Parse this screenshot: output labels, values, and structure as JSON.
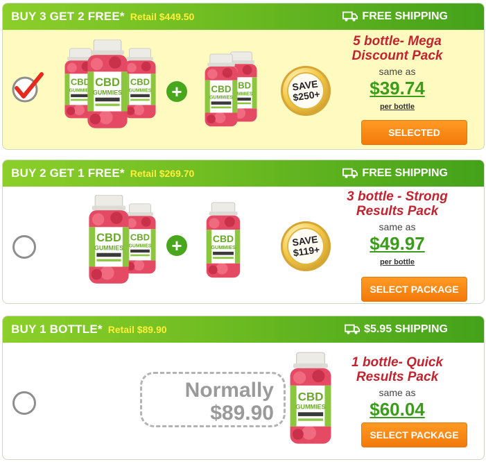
{
  "packages": [
    {
      "title": "BUY 3 GET 2 FREE*",
      "retail": "Retail $449.50",
      "shipping": "FREE SHIPPING",
      "selected": true,
      "name_line1": "5 bottle- Mega",
      "name_line2": "Discount Pack",
      "same_as": "same as",
      "price": "$39.74",
      "per_bottle": "per bottle",
      "button": "SELECTED",
      "badge_line1": "SAVE",
      "badge_line2": "$250+"
    },
    {
      "title": "BUY 2 GET 1 FREE*",
      "retail": "Retail $269.70",
      "shipping": "FREE SHIPPING",
      "selected": false,
      "name_line1": "3 bottle - Strong",
      "name_line2": "Results Pack",
      "same_as": "same as",
      "price": "$49.97",
      "per_bottle": "per bottle",
      "button": "SELECT PACKAGE",
      "badge_line1": "SAVE",
      "badge_line2": "$119+"
    },
    {
      "title": "BUY 1 BOTTLE*",
      "retail": "Retail $89.90",
      "shipping": "$5.95 SHIPPING",
      "selected": false,
      "name_line1": "1 bottle- Quick",
      "name_line2": "Results Pack",
      "same_as": "same as",
      "price": "$60.04",
      "button": "SELECT PACKAGE",
      "normally_line1": "Normally",
      "normally_line2": "$89.90"
    }
  ],
  "icons": {
    "shipping": "truck-icon",
    "selected": "checkmark-icon",
    "unselected": "radio-empty-icon",
    "plus": "plus-icon"
  },
  "colors": {
    "header_green": "#6ebc22",
    "retail_yellow": "#ffef3a",
    "selected_bg": "#fffbc0",
    "price_green": "#3a9c1a",
    "name_red": "#c3232f",
    "button_orange": "#f58a16"
  }
}
